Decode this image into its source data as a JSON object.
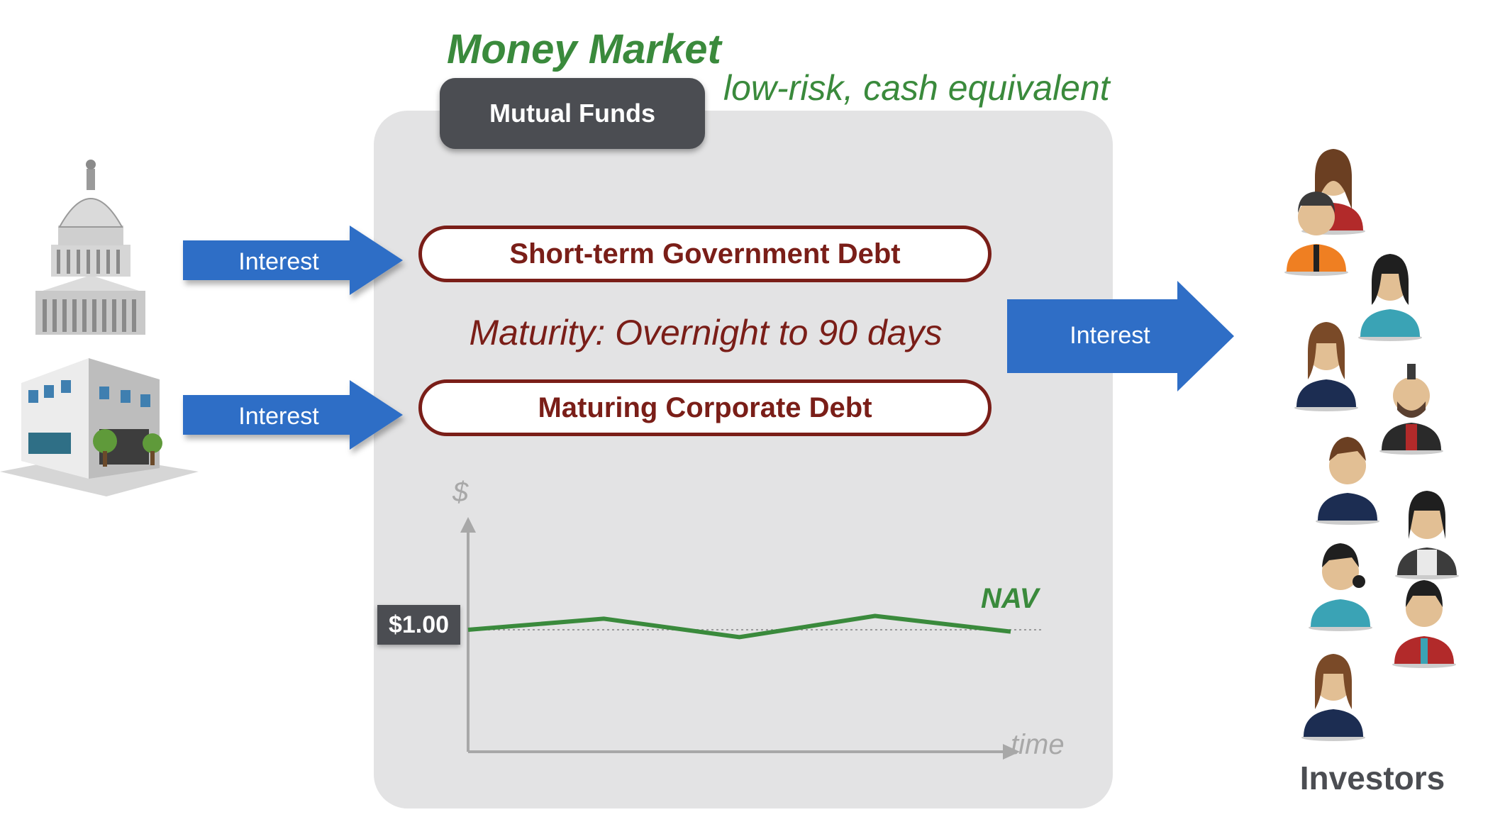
{
  "title": "Money Market",
  "subtitle": "low-risk, cash equivalent",
  "fund_tab": "Mutual Funds",
  "holdings": {
    "government": "Short-term Government Debt",
    "corporate": "Maturing Corporate Debt"
  },
  "maturity": "Maturity:  Overnight to 90 days",
  "flows": {
    "government_interest": "Interest",
    "corporate_interest": "Interest",
    "investor_interest": "Interest"
  },
  "chart": {
    "y_axis_label": "$",
    "x_axis_label": "time",
    "nav_price": "$1.00",
    "series_label": "NAV"
  },
  "chart_data": {
    "type": "line",
    "title": "",
    "xlabel": "time",
    "ylabel": "$",
    "reference_line": 1.0,
    "series": [
      {
        "name": "NAV",
        "values": [
          1.0,
          1.012,
          0.992,
          1.015,
          0.998
        ]
      }
    ]
  },
  "investors_label": "Investors",
  "colors": {
    "green": "#3a8a3c",
    "arrow_blue": "#2f6ec6",
    "debt_red": "#7a1e18",
    "box_gray": "#e3e3e4",
    "tab_dark": "#4b4d52"
  },
  "icons": [
    "capitol-building-icon",
    "office-building-icon",
    "investor-person-icon"
  ]
}
